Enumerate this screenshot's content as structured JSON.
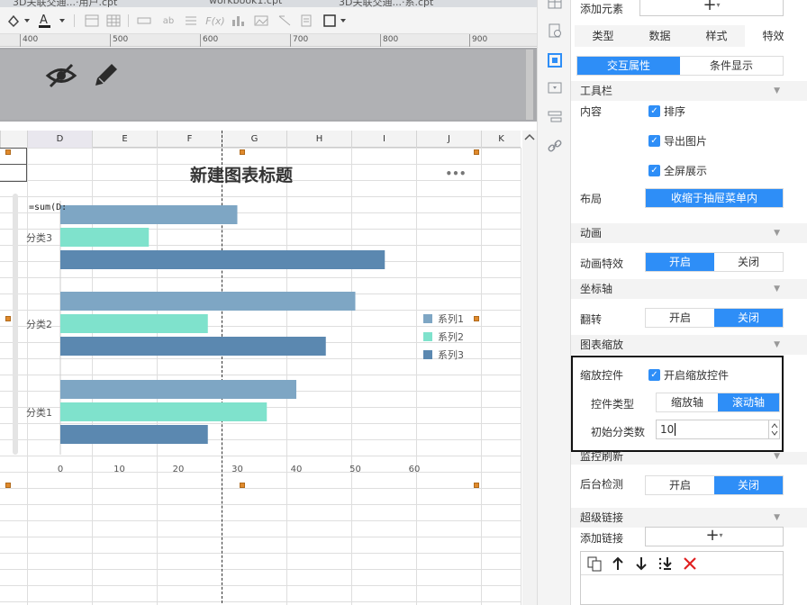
{
  "file_tabs": [
    "3D关联交通...·用户.cpt",
    "workbook1.cpt",
    "3D关联交通...·系.cpt"
  ],
  "ruler": [
    "400",
    "500",
    "600",
    "700",
    "800",
    "900"
  ],
  "columns": [
    "D",
    "E",
    "F",
    "G",
    "H",
    "I",
    "J",
    "K"
  ],
  "formula_cell": "=sum(D:",
  "chart_data": {
    "type": "bar",
    "title": "新建图表标题",
    "categories": [
      "分类1",
      "分类2",
      "分类3"
    ],
    "series": [
      {
        "name": "系列1",
        "values": [
          40,
          50,
          30
        ],
        "color": "#7ea6c4"
      },
      {
        "name": "系列2",
        "values": [
          35,
          25,
          15
        ],
        "color": "#7fe2cc"
      },
      {
        "name": "系列3",
        "values": [
          25,
          45,
          55
        ],
        "color": "#5b88b0"
      }
    ],
    "xlim": [
      0,
      60
    ],
    "xticks": [
      "0",
      "10",
      "20",
      "30",
      "40",
      "50",
      "60"
    ],
    "legend": "right",
    "more_label": "•••"
  },
  "panel": {
    "add_element_label": "添加元素",
    "add_symbol": "+",
    "tabs": [
      "类型",
      "数据",
      "样式",
      "特效"
    ],
    "active_tab": "特效",
    "subtabs": [
      "交互属性",
      "条件显示"
    ],
    "toolbar_section": "工具栏",
    "content_label": "内容",
    "content_checks": [
      "排序",
      "导出图片",
      "全屏展示"
    ],
    "layout_label": "布局",
    "layout_value": "收缩于抽屉菜单内",
    "animation_section": "动画",
    "animation_effect_label": "动画特效",
    "on": "开启",
    "off": "关闭",
    "axis_section": "坐标轴",
    "flip_label": "翻转",
    "zoom_section": "图表缩放",
    "zoom_control_label": "缩放控件",
    "zoom_control_check": "开启缩放控件",
    "control_type_label": "控件类型",
    "control_type_options": [
      "缩放轴",
      "滚动轴"
    ],
    "init_count_label": "初始分类数",
    "init_count_value": "10",
    "monitor_section": "监控刷新",
    "backend_label": "后台检测",
    "hyperlink_section": "超级链接",
    "add_link_label": "添加链接",
    "accent_color": "#2e8ef7"
  }
}
